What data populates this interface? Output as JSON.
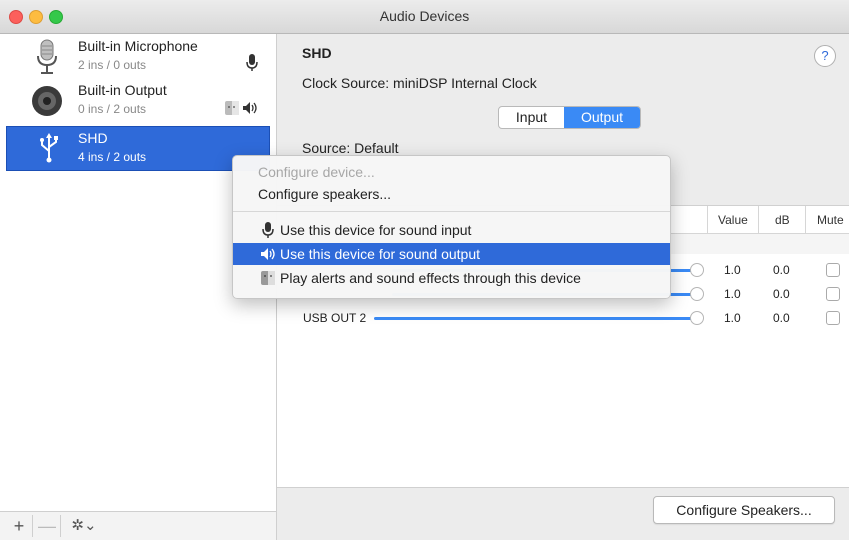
{
  "window": {
    "title": "Audio Devices"
  },
  "devices": [
    {
      "name": "Built-in Microphone",
      "channels": "2 ins / 0 outs",
      "icon": "microphone-icon"
    },
    {
      "name": "Built-in Output",
      "channels": "0 ins / 2 outs",
      "icon": "speaker-icon"
    },
    {
      "name": "SHD",
      "channels": "4 ins / 2 outs",
      "icon": "usb-icon",
      "selected": true
    }
  ],
  "sidebar_toolbar": {
    "add": "+",
    "remove": "—",
    "actions": "✲⌄"
  },
  "detail": {
    "device_name": "SHD",
    "clock_source": "Clock Source:  miniDSP Internal Clock",
    "help": "?",
    "tabs": [
      "Input",
      "Output"
    ],
    "selected_tab": "Output",
    "source": "Source:  Default"
  },
  "table": {
    "headers": {
      "value": "Value",
      "db": "dB",
      "mute": "Mute"
    },
    "rows": [
      {
        "label": "",
        "value": "1.0",
        "db": "0.0",
        "level": 1.0
      },
      {
        "label": "",
        "value": "1.0",
        "db": "0.0",
        "level": 1.0
      },
      {
        "label": "USB OUT 2",
        "value": "1.0",
        "db": "0.0",
        "level": 1.0
      }
    ]
  },
  "configure_speakers_button": "Configure Speakers...",
  "context_menu": {
    "items": [
      {
        "label": "Configure device...",
        "enabled": false
      },
      {
        "label": "Configure speakers...",
        "enabled": true
      },
      {
        "label": "Use this device for sound input",
        "icon": "microphone-icon"
      },
      {
        "label": "Use this device for sound output",
        "icon": "speaker-icon",
        "highlighted": true
      },
      {
        "label": "Play alerts and sound effects through this device",
        "icon": "finder-icon"
      }
    ]
  },
  "colors": {
    "accent": "#2f6ad9",
    "segment_selected": "#3a8af5"
  }
}
